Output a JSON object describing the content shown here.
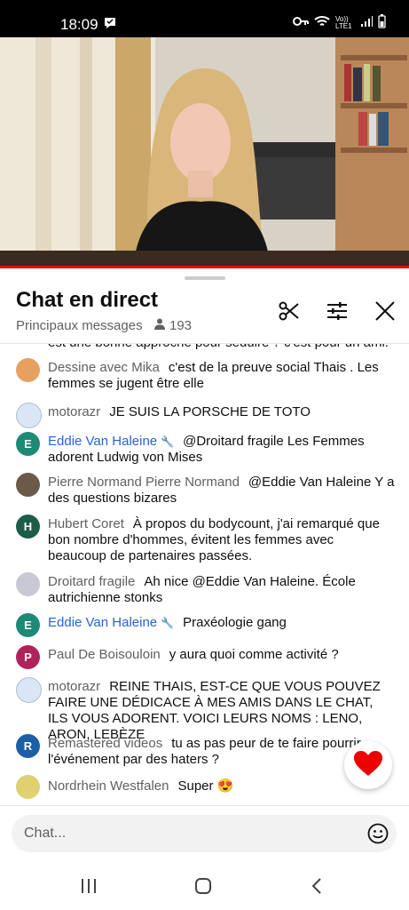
{
  "status_bar": {
    "time": "18:09",
    "network": "Vo)) LTE1"
  },
  "chat_header": {
    "title": "Chat en direct",
    "subtitle": "Principaux messages",
    "viewers": "193"
  },
  "messages": [
    {
      "author": "",
      "text": "est une bonne approche pour séduire ? c'est pour un ami.",
      "avatar_color": "#f5f5f5",
      "avatar_letter": ""
    },
    {
      "author": "Dessine avec Mika",
      "text": "c'est de la preuve social Thais . Les femmes se jugent être elle",
      "avatar_color": "#e8a060",
      "avatar_letter": ""
    },
    {
      "author": "motorazr",
      "text": "JE SUIS LA PORSCHE DE TOTO",
      "avatar_color": "#d9e6f5",
      "avatar_letter": ""
    },
    {
      "author": "Eddie Van Haleine",
      "moderator": true,
      "text": "@Droitard fragile Les Femmes adorent Ludwig von Mises",
      "avatar_color": "#1e8a75",
      "avatar_letter": "E"
    },
    {
      "author": "Pierre Normand Pierre Normand",
      "text": "@Eddie Van Haleine Y a des questions bizares",
      "avatar_color": "#6b5a4a",
      "avatar_letter": ""
    },
    {
      "author": "Hubert Coret",
      "text": "À propos du bodycount, j'ai remarqué que bon nombre d'hommes, évitent les femmes avec beaucoup de partenaires passées.",
      "avatar_color": "#1d5c4a",
      "avatar_letter": "H"
    },
    {
      "author": "Droitard fragile",
      "text": "Ah nice @Eddie Van Haleine. École autrichienne stonks",
      "avatar_color": "#c9c9d6",
      "avatar_letter": ""
    },
    {
      "author": "Eddie Van Haleine",
      "moderator": true,
      "text": "Praxéologie gang",
      "avatar_color": "#1e8a75",
      "avatar_letter": "E"
    },
    {
      "author": "Paul De Boisouloin",
      "text": "y aura quoi comme activité ?",
      "avatar_color": "#b0235a",
      "avatar_letter": "P"
    },
    {
      "author": "motorazr",
      "text": "REINE THAIS, EST-CE QUE VOUS POUVEZ FAIRE UNE DÉDICACE À MES AMIS DANS LE CHAT, ILS VOUS ADORENT. VOICI LEURS NOMS : LENO, ARON, LEBÈZE",
      "avatar_color": "#d9e6f5",
      "avatar_letter": ""
    },
    {
      "author": "Remastered videos",
      "text": "tu as pas peur de te faire pourrir l'événement par des haters ?",
      "avatar_color": "#1c5fa8",
      "avatar_letter": "R"
    },
    {
      "author": "Nordrhein Westfalen",
      "text": "Super 😍",
      "avatar_color": "#e0d070",
      "avatar_letter": ""
    }
  ],
  "input": {
    "placeholder": "Chat..."
  },
  "colors": {
    "accent_red": "#ee0000",
    "moderator_blue": "#2962d9",
    "author_gray": "#606060"
  }
}
